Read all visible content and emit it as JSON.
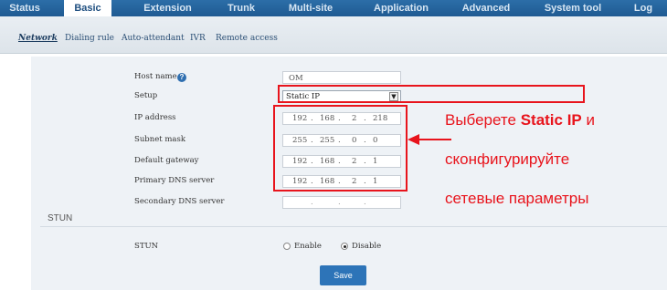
{
  "top_nav": {
    "tabs": [
      {
        "label": "Status"
      },
      {
        "label": "Basic"
      },
      {
        "label": "Extension"
      },
      {
        "label": "Trunk"
      },
      {
        "label": "Multi-site"
      },
      {
        "label": "Application"
      },
      {
        "label": "Advanced"
      },
      {
        "label": "System tool"
      },
      {
        "label": "Log"
      }
    ],
    "active": "Basic"
  },
  "sub_nav": {
    "items": [
      {
        "label": "Network"
      },
      {
        "label": "Dialing rule"
      },
      {
        "label": "Auto-attendant"
      },
      {
        "label": "IVR"
      },
      {
        "label": "Remote access"
      }
    ],
    "active": "Network"
  },
  "form": {
    "host_name": {
      "label": "Host name",
      "value": "OM"
    },
    "setup": {
      "label": "Setup",
      "value": "Static IP"
    },
    "ip_address": {
      "label": "IP address",
      "octets": [
        "192",
        "168",
        "2",
        "218"
      ]
    },
    "subnet_mask": {
      "label": "Subnet mask",
      "octets": [
        "255",
        "255",
        "0",
        "0"
      ]
    },
    "default_gateway": {
      "label": "Default gateway",
      "octets": [
        "192",
        "168",
        "2",
        "1"
      ]
    },
    "primary_dns": {
      "label": "Primary DNS server",
      "octets": [
        "192",
        "168",
        "2",
        "1"
      ]
    },
    "secondary_dns": {
      "label": "Secondary DNS server",
      "octets": [
        "",
        "",
        "",
        ""
      ]
    }
  },
  "stun_section": {
    "title": "STUN",
    "field_label": "STUN",
    "options": [
      {
        "label": "Enable",
        "selected": false
      },
      {
        "label": "Disable",
        "selected": true
      }
    ]
  },
  "save_label": "Save",
  "annotation": {
    "line1_prefix": "Выберете ",
    "line1_bold": "Static IP",
    "line1_suffix": " и",
    "line2": "сконфигурируйте",
    "line3": "сетевые параметры"
  },
  "colors": {
    "nav_bg": "#2468a4",
    "accent_red": "#e8141c",
    "save_button": "#2d74b8"
  },
  "icons": {
    "help": "help-icon",
    "dropdown": "chevron-down-icon",
    "arrow": "red-arrow-icon"
  }
}
